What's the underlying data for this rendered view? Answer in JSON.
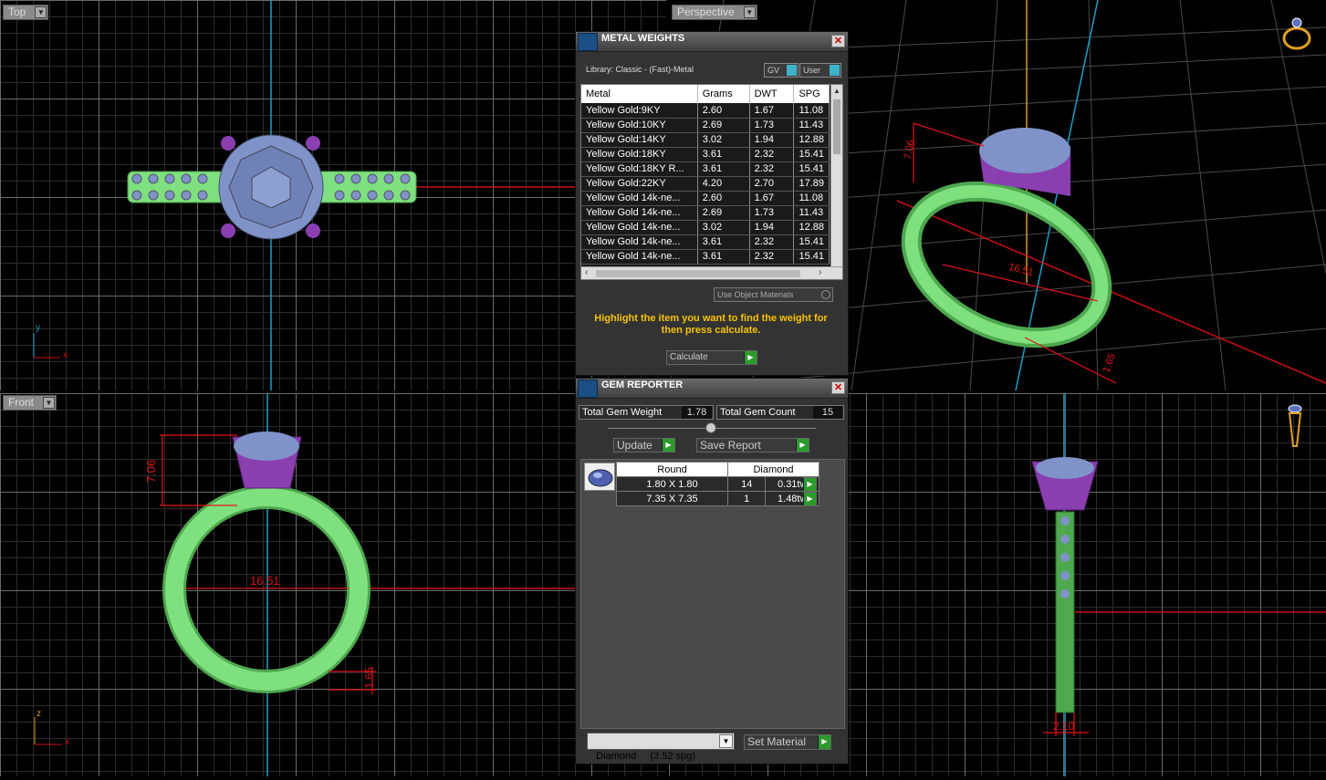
{
  "viewports": {
    "top": {
      "label": "Top"
    },
    "perspective": {
      "label": "Perspective"
    },
    "front": {
      "label": "Front"
    }
  },
  "axes": {
    "top_x": "x",
    "top_y": "y",
    "front_x": "x",
    "front_z": "z"
  },
  "dimensions": {
    "front_height": "7.06",
    "front_width": "16.51",
    "front_band": "1.65",
    "persp_height": "7.06",
    "persp_width": "16.51",
    "persp_band": "1.65",
    "side_width": "2.10"
  },
  "metal_weights": {
    "title": "METAL WEIGHTS",
    "library": "Library: Classic - (Fast)-Metal",
    "gv_label": "GV",
    "user_label": "User",
    "columns": [
      "Metal",
      "Grams",
      "DWT",
      "SPG"
    ],
    "rows": [
      [
        "Yellow Gold:9KY",
        "2.60",
        "1.67",
        "11.08"
      ],
      [
        "Yellow Gold:10KY",
        "2.69",
        "1.73",
        "11.43"
      ],
      [
        "Yellow Gold:14KY",
        "3.02",
        "1.94",
        "12.88"
      ],
      [
        "Yellow Gold:18KY",
        "3.61",
        "2.32",
        "15.41"
      ],
      [
        "Yellow Gold:18KY R...",
        "3.61",
        "2.32",
        "15.41"
      ],
      [
        "Yellow Gold:22KY",
        "4.20",
        "2.70",
        "17.89"
      ],
      [
        "Yellow Gold 14k-ne...",
        "2.60",
        "1.67",
        "11.08"
      ],
      [
        "Yellow Gold 14k-ne...",
        "2.69",
        "1.73",
        "11.43"
      ],
      [
        "Yellow Gold 14k-ne...",
        "3.02",
        "1.94",
        "12.88"
      ],
      [
        "Yellow Gold 14k-ne...",
        "3.61",
        "2.32",
        "15.41"
      ],
      [
        "Yellow Gold 14k-ne...",
        "3.61",
        "2.32",
        "15.41"
      ]
    ],
    "use_object_materials": "Use Object Materials",
    "hint": "Highlight the item you want to find the weight for then press calculate.",
    "calculate_label": "Calculate"
  },
  "gem_reporter": {
    "title": "GEM REPORTER",
    "total_weight_label": "Total Gem Weight",
    "total_weight": "1.78",
    "total_count_label": "Total Gem Count",
    "total_count": "15",
    "update_label": "Update",
    "save_report_label": "Save Report",
    "table_head": [
      "Round",
      "Diamond"
    ],
    "rows": [
      {
        "size": "1.80 X 1.80",
        "count": "14",
        "weight": "0.31tw"
      },
      {
        "size": "7.35 X 7.35",
        "count": "1",
        "weight": "1.48tw"
      }
    ],
    "material_select": "Diamond     (3.52 spg)",
    "set_material_label": "Set Material"
  },
  "colors": {
    "band": "#7fe07f",
    "prong": "#8a3fb0",
    "gem": "#7f93c8",
    "dim": "#e01515",
    "axis": "#1aa0c8"
  },
  "icons": [
    "ring-view-icon",
    "side-ring-view-icon",
    "metal-weights-icon",
    "gem-reporter-icon",
    "close-icon",
    "dropdown-icon",
    "play-arrow-icon"
  ]
}
